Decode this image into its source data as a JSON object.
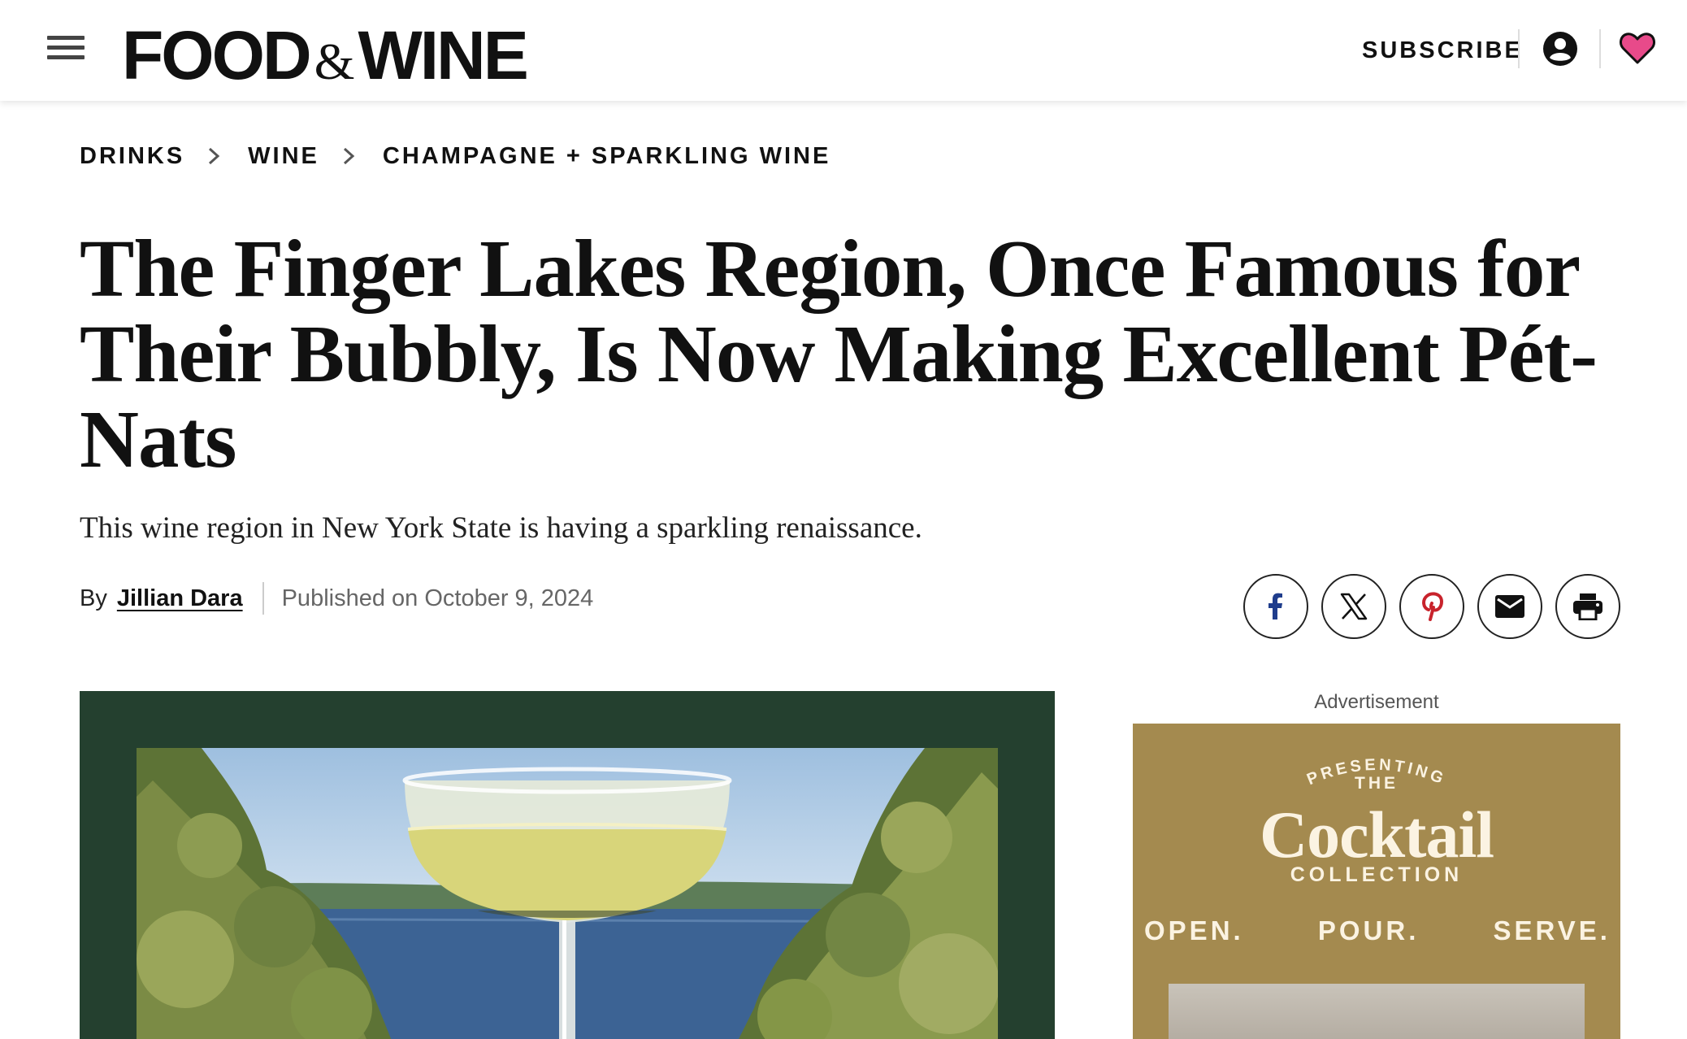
{
  "header": {
    "logo": {
      "left": "FOOD",
      "amp": "&",
      "right": "WINE"
    },
    "subscribe_label": "SUBSCRIBE"
  },
  "breadcrumb": [
    "DRINKS",
    "WINE",
    "CHAMPAGNE + SPARKLING WINE"
  ],
  "article": {
    "headline": "The Finger Lakes Region, Once Famous for Their Bubbly, Is Now Making Excellent Pét-Nats",
    "dek": "This wine region in New York State is having a sparkling renaissance.",
    "byline_prefix": "By",
    "author": "Jillian Dara",
    "published": "Published on October 9, 2024"
  },
  "share": [
    "facebook-icon",
    "x-icon",
    "pinterest-icon",
    "email-icon",
    "print-icon"
  ],
  "colors": {
    "heart": "#e84a8a",
    "pinterest": "#c8232c",
    "facebook": "#1f3d8c",
    "hero_frame": "#24402f",
    "ad_background": "#a48a4f",
    "ad_text": "#fbf3e2"
  },
  "ad": {
    "label": "Advertisement",
    "presenting": "PRESENTING",
    "the": "THE",
    "title": "Cocktail",
    "subtitle": "COLLECTION",
    "taglines": [
      "OPEN.",
      "POUR.",
      "SERVE."
    ]
  }
}
